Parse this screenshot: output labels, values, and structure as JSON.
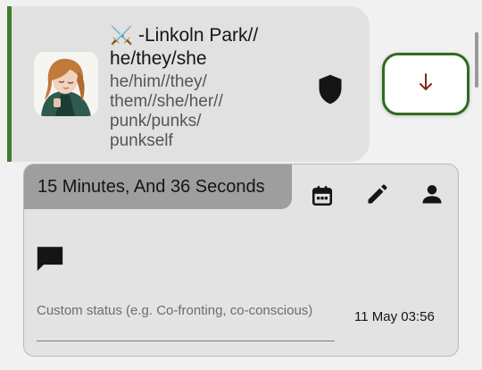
{
  "member": {
    "name": "⚔️ -Linkoln Park//",
    "pronouns_primary": "he/they/she",
    "pronouns_extra": "he/him//they/\nthem//she/her//\npunk/punks/\npunkself",
    "avatar_icon": "avatar-anime-character",
    "accent_color": "#3f7d2a",
    "privacy_icon": "shield-icon"
  },
  "switch_button": {
    "icon": "arrow-down-icon",
    "border_color": "#2f6b1f",
    "arrow_color": "#7a2a1a"
  },
  "front": {
    "duration": "15 Minutes, And 36 Seconds",
    "actions": [
      "calendar-icon",
      "edit-icon",
      "person-icon"
    ],
    "comment_icon": "chat-bubble-icon",
    "custom_status_placeholder": "Custom status (e.g. Co-fronting, co-conscious)",
    "custom_status_value": "",
    "timestamp": "11 May 03:56"
  }
}
